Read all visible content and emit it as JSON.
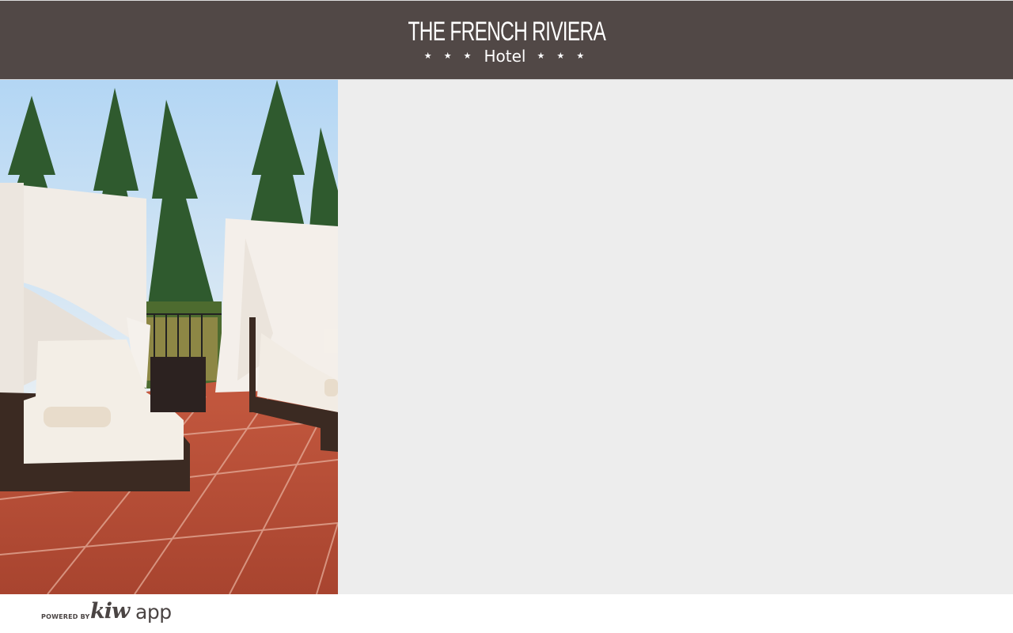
{
  "header": {
    "title": "THE FRENCH RIVIERA",
    "subtitle": "Hotel",
    "stars_left": "★ ★ ★",
    "stars_right": "★ ★ ★",
    "background_color": "#514846"
  },
  "content": {
    "background_color": "#ededed",
    "hero_image": "hotel-terrace-daybeds-photo"
  },
  "footer": {
    "powered_label": "POWERED BY",
    "brand_kiw": "kiw",
    "brand_app": "app"
  }
}
